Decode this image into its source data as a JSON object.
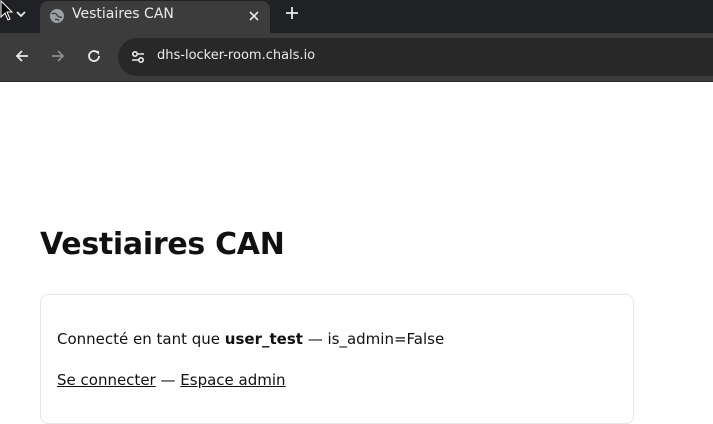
{
  "browser": {
    "tab_title": "Vestiaires CAN",
    "url": "dhs-locker-room.chals.io",
    "colors": {
      "tabstrip": "#202124",
      "toolbar": "#3c3c3c",
      "omnibox": "#282828",
      "text": "#e8eaed"
    },
    "icons": [
      "cursor-icon",
      "tab-menu-chevron-icon",
      "globe-icon",
      "close-icon",
      "plus-icon",
      "back-arrow-icon",
      "forward-arrow-icon",
      "reload-icon",
      "site-info-icon"
    ]
  },
  "page": {
    "title": "Vestiaires CAN",
    "status": {
      "prefix": "Connecté en tant que",
      "username": "user_test",
      "separator": "—",
      "admin_flag": "is_admin=False"
    },
    "links": {
      "login": "Se connecter",
      "separator": "—",
      "admin": "Espace admin"
    }
  }
}
